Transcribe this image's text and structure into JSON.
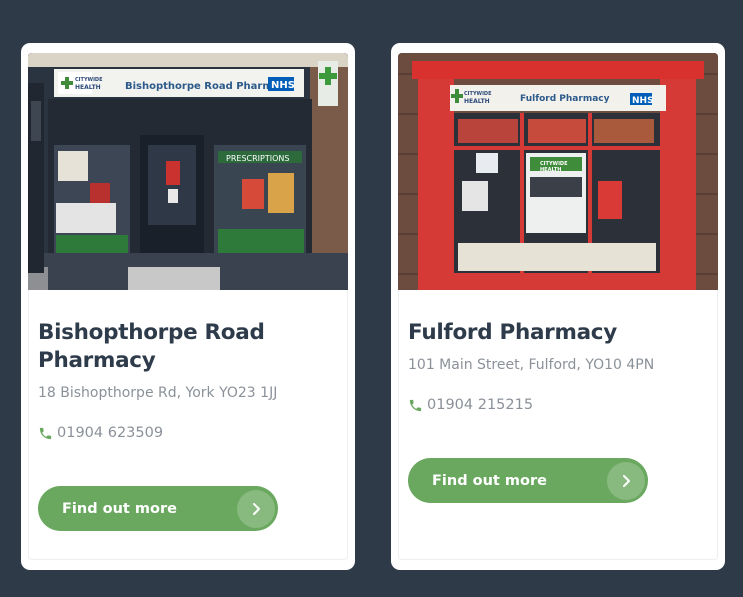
{
  "colors": {
    "background": "#2f3a48",
    "accent_green": "#6aa860",
    "title": "#2e3b4a",
    "muted_text": "#8b9199"
  },
  "cards": [
    {
      "photo": {
        "sign_brand_top": "CITYWIDE",
        "sign_brand_bottom": "HEALTH",
        "sign_name": "Bishopthorpe Road Pharmacy",
        "sign_nhs": "NHS",
        "window_text": "PRESCRIPTIONS"
      },
      "title": "Bishopthorpe Road Pharmacy",
      "address": "18 Bishopthorpe Rd, York YO23 1JJ",
      "phone_icon": "phone-icon",
      "phone": "01904 623509",
      "button_label": "Find out more",
      "button_icon": "chevron-right-icon"
    },
    {
      "photo": {
        "sign_brand_top": "CITYWIDE",
        "sign_brand_bottom": "HEALTH",
        "sign_name": "Fulford Pharmacy",
        "sign_nhs": "NHS",
        "poster_brand_top": "CITYWIDE",
        "poster_brand_bottom": "HEALTH"
      },
      "title": "Fulford Pharmacy",
      "address": "101 Main Street, Fulford, YO10 4PN",
      "phone_icon": "phone-icon",
      "phone": "01904 215215",
      "button_label": "Find out more",
      "button_icon": "chevron-right-icon"
    }
  ]
}
